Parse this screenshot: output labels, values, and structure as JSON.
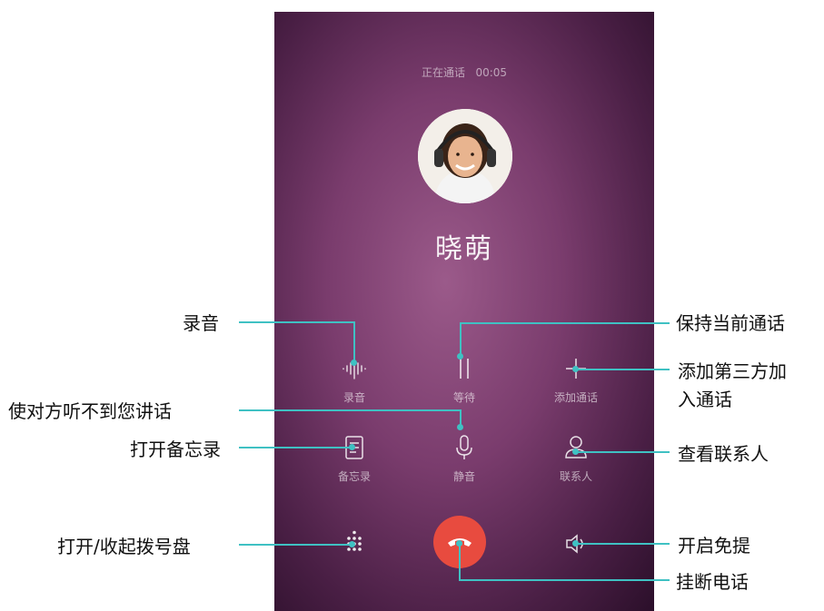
{
  "call": {
    "status": "正在通话",
    "time": "00:05",
    "name": "晓萌"
  },
  "buttons": {
    "record": {
      "label": "录音",
      "icon": "waveform-icon"
    },
    "hold": {
      "label": "等待",
      "icon": "pause-icon"
    },
    "add_call": {
      "label": "添加通话",
      "icon": "plus-icon"
    },
    "memo": {
      "label": "备忘录",
      "icon": "note-icon"
    },
    "mute": {
      "label": "静音",
      "icon": "microphone-icon"
    },
    "contacts": {
      "label": "联系人",
      "icon": "person-icon"
    },
    "dialpad": {
      "icon": "dialpad-icon"
    },
    "end_call": {
      "icon": "end-call-icon"
    },
    "speaker": {
      "icon": "speaker-icon"
    }
  },
  "callouts": {
    "record": "录音",
    "hold": "保持当前通话",
    "add_call_1": "添加第三方加",
    "add_call_2": "入通话",
    "mute": "使对方听不到您讲话",
    "memo": "打开备忘录",
    "contacts": "查看联系人",
    "dialpad": "打开/收起拨号盘",
    "speaker": "开启免提",
    "end_call": "挂断电话"
  },
  "colors": {
    "accent_line": "#3fc1c3",
    "end_call": "#e84b3f"
  }
}
